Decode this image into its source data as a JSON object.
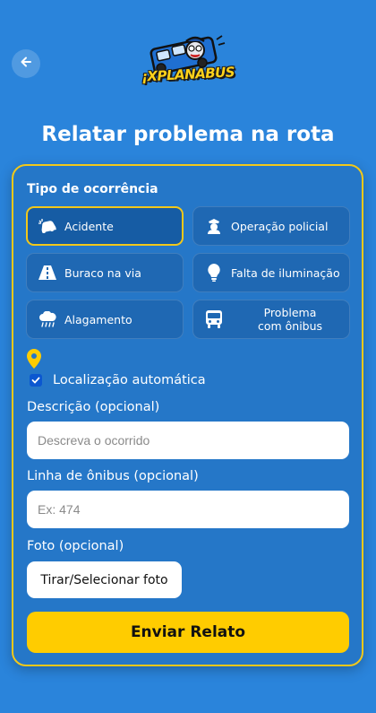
{
  "header": {
    "back_icon": "arrow-left-icon",
    "logo_text": "¡XPLANABUS",
    "title": "Relatar problema na rota"
  },
  "form": {
    "type_label": "Tipo de ocorrência",
    "types": [
      {
        "label": "Acidente",
        "icon": "car-crash-icon",
        "selected": true
      },
      {
        "label": "Operação policial",
        "icon": "police-officer-icon",
        "selected": false
      },
      {
        "label": "Buraco na via",
        "icon": "road-icon",
        "selected": false
      },
      {
        "label": "Falta de iluminação",
        "icon": "lightbulb-icon",
        "selected": false
      },
      {
        "label": "Alagamento",
        "icon": "cloud-rain-icon",
        "selected": false
      },
      {
        "label": "Problema com ônibus",
        "icon": "bus-icon",
        "selected": false
      }
    ],
    "location": {
      "icon": "map-pin-icon",
      "label": "Localização automática",
      "checked": true
    },
    "description": {
      "label": "Descrição (opcional)",
      "placeholder": "Descreva o ocorrido",
      "value": ""
    },
    "bus_line": {
      "label": "Linha de ônibus (opcional)",
      "placeholder": "Ex: 474",
      "value": ""
    },
    "photo": {
      "label": "Foto (opcional)",
      "button": "Tirar/Selecionar foto"
    },
    "submit": "Enviar Relato"
  },
  "colors": {
    "background": "#2a84db",
    "card": "#2577c8",
    "accent": "#f2c81a",
    "submit": "#ffcc00"
  }
}
